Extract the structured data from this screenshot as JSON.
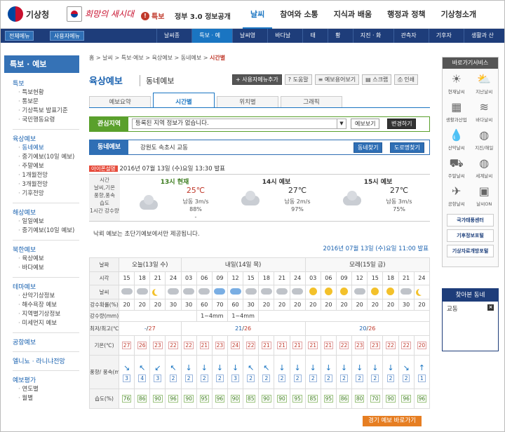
{
  "header": {
    "logo_text": "기상청",
    "slogan": "희망의 새시대",
    "tukbo": "특보",
    "gov30": "정부 3.0 정보공개",
    "menu": [
      "날씨",
      "참여와 소통",
      "지식과 배움",
      "행정과 정책",
      "기상청소개"
    ],
    "menu_active": "날씨"
  },
  "subnav": {
    "all_menu": "전체메뉴",
    "user_menu": "사용자메뉴",
    "items": [
      "날씨종합",
      "특보 · 예보",
      "날씨영상",
      "바다날씨",
      "태풍",
      "황사",
      "지진 · 화산",
      "관측자료",
      "기후자료",
      "생활과 산업"
    ],
    "active": "특보 · 예보"
  },
  "left": {
    "title": "특보 · 예보",
    "sections": [
      {
        "title": "특보",
        "items": [
          "특보현황",
          "통보문",
          "기상특보 발표기준",
          "국민행동요령"
        ]
      },
      {
        "title": "육상예보",
        "items": [
          "동네예보",
          "중기예보(10일 예보)",
          "주말예보",
          "1개월전망",
          "3개월전망",
          "기후전망"
        ]
      },
      {
        "title": "해상예보",
        "items": [
          "일일예보",
          "중기예보(10일 예보)"
        ]
      },
      {
        "title": "북한예보",
        "items": [
          "육상예보",
          "바다예보"
        ]
      },
      {
        "title": "테마예보",
        "items": [
          "산악기상정보",
          "해수욕장 예보",
          "지역별기상정보",
          "미세먼지 예보"
        ]
      },
      {
        "title": "공항예보",
        "items": []
      },
      {
        "title": "엘니뇨 · 라니냐전망",
        "items": []
      },
      {
        "title": "예보평가",
        "items": [
          "연도별",
          "월별"
        ]
      }
    ],
    "active_item": "동네예보"
  },
  "breadcrumb": [
    "홈",
    "날씨",
    "특보·예보",
    "육상예보",
    "동네예보",
    "시간별"
  ],
  "page": {
    "title": "육상예보",
    "subtitle": "동네예보",
    "tools": [
      "사용자메뉴추가",
      "도움말",
      "예보용어보기",
      "스크랩",
      "인쇄"
    ]
  },
  "tabs": [
    "예보요약",
    "시간별",
    "위치별",
    "그래픽"
  ],
  "tab_active": "시간별",
  "interest": {
    "label": "관심지역",
    "select_value": "등록된 지역 정보가 없습니다.",
    "view_btn": "예보보기",
    "change_btn": "변경하기"
  },
  "dongnae": {
    "label": "동네예보",
    "location": "강원도 속초시 교동",
    "find_btn": "동네찾기",
    "map_btn": "도로명찾기"
  },
  "announce": {
    "tag": "아이폰설명",
    "text": "2016년 07월 13일 (수)요일 13:30 발표"
  },
  "summary": {
    "labels": [
      "시간",
      "날씨,기온",
      "풍향,풍속",
      "습도",
      "1시간 강수량"
    ],
    "cols": [
      {
        "head": "13시 현재",
        "temp": "25℃",
        "wind": "남동 3m/s",
        "hum": "88%",
        "rain": "-"
      },
      {
        "head": "14시 예보",
        "temp": "27℃",
        "wind": "남동 2m/s",
        "hum": "97%",
        "rain": ""
      },
      {
        "head": "15시 예보",
        "temp": "27℃",
        "wind": "남동 3m/s",
        "hum": "75%",
        "rain": ""
      }
    ]
  },
  "note": "낙뢰 예보는 초단기예보에서만 제공됩니다.",
  "published": "2016년 07월 13일 (수)요일 11:00 발표",
  "table": {
    "row_labels": {
      "day": "날짜",
      "time": "시각",
      "weather": "날씨",
      "pop": "강수확률(%)",
      "rain": "강수량(mm)",
      "minmax": "최저/최고(℃)",
      "temp": "기온(℃)",
      "wind": "풍향/ 풍속(m/s)",
      "hum": "습도(%)"
    },
    "days": [
      {
        "label": "오늘(13일 수)",
        "span": 4
      },
      {
        "label": "내일(14일 목)",
        "span": 8
      },
      {
        "label": "모레(15일 금)",
        "span": 8
      }
    ],
    "times": [
      "15",
      "18",
      "21",
      "24",
      "03",
      "06",
      "09",
      "12",
      "15",
      "18",
      "21",
      "24",
      "03",
      "06",
      "09",
      "12",
      "15",
      "18",
      "21",
      "24"
    ],
    "weather": [
      "cl",
      "cl",
      "mn",
      "cl",
      "cl",
      "cl",
      "ra",
      "ra",
      "cl",
      "cl",
      "cl",
      "cl",
      "sun",
      "sun",
      "sun",
      "cl",
      "sun",
      "sun",
      "cl",
      "mn"
    ],
    "pop": [
      "20",
      "20",
      "20",
      "30",
      "30",
      "60",
      "70",
      "60",
      "30",
      "20",
      "20",
      "20",
      "20",
      "20",
      "20",
      "20",
      "20",
      "20",
      "30",
      "20"
    ],
    "rain": [
      {
        "v": "",
        "span": 5
      },
      {
        "v": "1~4mm",
        "span": 2
      },
      {
        "v": "1~4mm",
        "span": 2
      },
      {
        "v": "",
        "span": 11
      }
    ],
    "minmax": [
      {
        "min": "-",
        "max": "27",
        "span": 4
      },
      {
        "min": "21",
        "max": "26",
        "span": 8
      },
      {
        "min": "20",
        "max": "26",
        "span": 8
      }
    ],
    "temp": [
      "27",
      "26",
      "23",
      "22",
      "22",
      "21",
      "23",
      "24",
      "22",
      "21",
      "21",
      "21",
      "21",
      "21",
      "22",
      "23",
      "23",
      "22",
      "22",
      "20"
    ],
    "wind_dir": [
      "↘",
      "↖",
      "↙",
      "↖",
      "↓",
      "↓",
      "↓",
      "↓",
      "↖",
      "↖",
      "↓",
      "↓",
      "↓",
      "↓",
      "↓",
      "↓",
      "↓",
      "↓",
      "↘",
      "↑"
    ],
    "wind_spd": [
      "3",
      "4",
      "3",
      "2",
      "2",
      "2",
      "2",
      "3",
      "2",
      "2",
      "2",
      "2",
      "2",
      "2",
      "2",
      "2",
      "2",
      "2",
      "2",
      "1"
    ],
    "hum": [
      "76",
      "86",
      "90",
      "96",
      "90",
      "95",
      "96",
      "90",
      "85",
      "90",
      "90",
      "95",
      "85",
      "95",
      "86",
      "80",
      "70",
      "90",
      "96",
      "96"
    ]
  },
  "more_btn": "경기 예보 바로가기",
  "right": {
    "title": "바로가기서비스",
    "items": [
      {
        "label": "현재날씨",
        "icon": "sun-icon"
      },
      {
        "label": "지난날씨",
        "icon": "sun-cloud-icon"
      },
      {
        "label": "생활과산업",
        "icon": "building-icon"
      },
      {
        "label": "바다날씨",
        "icon": "wave-icon"
      },
      {
        "label": "산악날씨",
        "icon": "drop-icon"
      },
      {
        "label": "지진/해일",
        "icon": "globe-icon"
      },
      {
        "label": "주말날씨",
        "icon": "car-icon"
      },
      {
        "label": "세계날씨",
        "icon": "globe-icon"
      },
      {
        "label": "공항날씨",
        "icon": "plane-icon"
      },
      {
        "label": "날씨ON",
        "icon": "tv-icon"
      }
    ],
    "buttons": [
      "국가태풍센터",
      "기후정보포털",
      "기상자료개방포털"
    ]
  },
  "favorites": {
    "title": "찾아본 동네",
    "items": [
      "교동"
    ]
  }
}
